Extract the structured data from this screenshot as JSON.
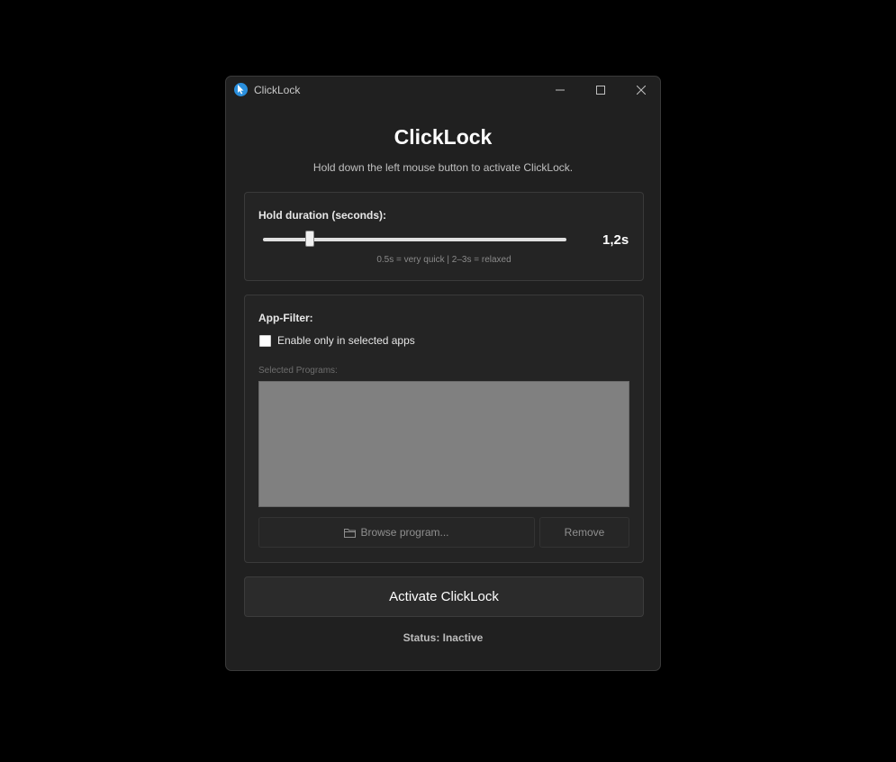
{
  "window": {
    "title": "ClickLock",
    "icon": "cursor-icon"
  },
  "header": {
    "title": "ClickLock",
    "subtitle": "Hold down the left mouse button to activate ClickLock."
  },
  "duration": {
    "label": "Hold duration (seconds):",
    "value_display": "1,2s",
    "hint": "0.5s = very quick | 2–3s = relaxed"
  },
  "filter": {
    "label": "App-Filter:",
    "checkbox_label": "Enable only in selected apps",
    "checkbox_checked": false,
    "programs_label": "Selected Programs:",
    "browse_label": "Browse program...",
    "remove_label": "Remove"
  },
  "actions": {
    "activate_label": "Activate ClickLock"
  },
  "status": {
    "text": "Status: Inactive"
  },
  "colors": {
    "background": "#000000",
    "window": "#202020",
    "accent": "#2a8fdd",
    "list": "#808080"
  }
}
